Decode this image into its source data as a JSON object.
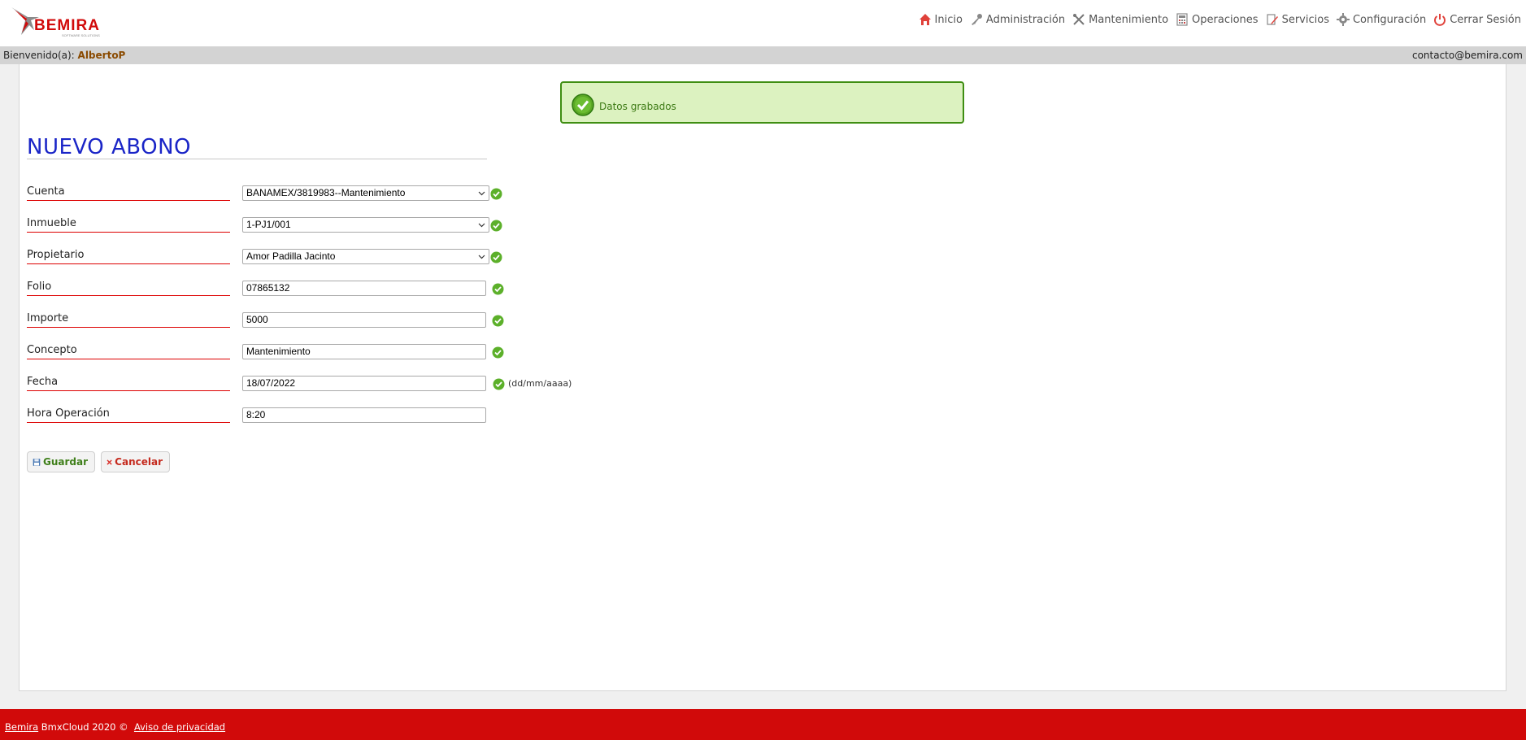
{
  "brand": {
    "logo_text": "BEMIRA",
    "logo_tagline": "SOFTWARE SOLUTIONS"
  },
  "nav": [
    {
      "label": "Inicio",
      "icon": "home-icon"
    },
    {
      "label": "Administración",
      "icon": "key-icon"
    },
    {
      "label": "Mantenimiento",
      "icon": "tools-icon"
    },
    {
      "label": "Operaciones",
      "icon": "calculator-icon"
    },
    {
      "label": "Servicios",
      "icon": "document-edit-icon"
    },
    {
      "label": "Configuración",
      "icon": "gear-icon"
    },
    {
      "label": "Cerrar Sesión",
      "icon": "power-icon"
    }
  ],
  "welcome": {
    "prefix": "Bienvenido(a):",
    "user": "AlbertoP",
    "contact": "contacto@bemira.com"
  },
  "alert": {
    "message": "Datos grabados"
  },
  "page": {
    "title": "NUEVO ABONO"
  },
  "form": {
    "cuenta": {
      "label": "Cuenta",
      "value": "BANAMEX/3819983--Mantenimiento"
    },
    "inmueble": {
      "label": "Inmueble",
      "value": "1-PJ1/001"
    },
    "propietario": {
      "label": "Propietario",
      "value": "Amor Padilla Jacinto"
    },
    "folio": {
      "label": "Folio",
      "value": "07865132"
    },
    "importe": {
      "label": "Importe",
      "value": "5000"
    },
    "concepto": {
      "label": "Concepto",
      "value": "Mantenimiento"
    },
    "fecha": {
      "label": "Fecha",
      "value": "18/07/2022",
      "hint": "(dd/mm/aaaa)"
    },
    "hora": {
      "label": "Hora Operación",
      "value": "8:20"
    }
  },
  "buttons": {
    "save": "Guardar",
    "cancel": "Cancelar"
  },
  "footer": {
    "brand_link": "Bemira",
    "text": "BmxCloud 2020 ©",
    "privacy_link": "Aviso de privacidad"
  },
  "colors": {
    "footer_bg": "#d10a0a",
    "title": "#1a25c7",
    "success_border": "#3f8e12",
    "success_bg": "#dcf2c0"
  }
}
